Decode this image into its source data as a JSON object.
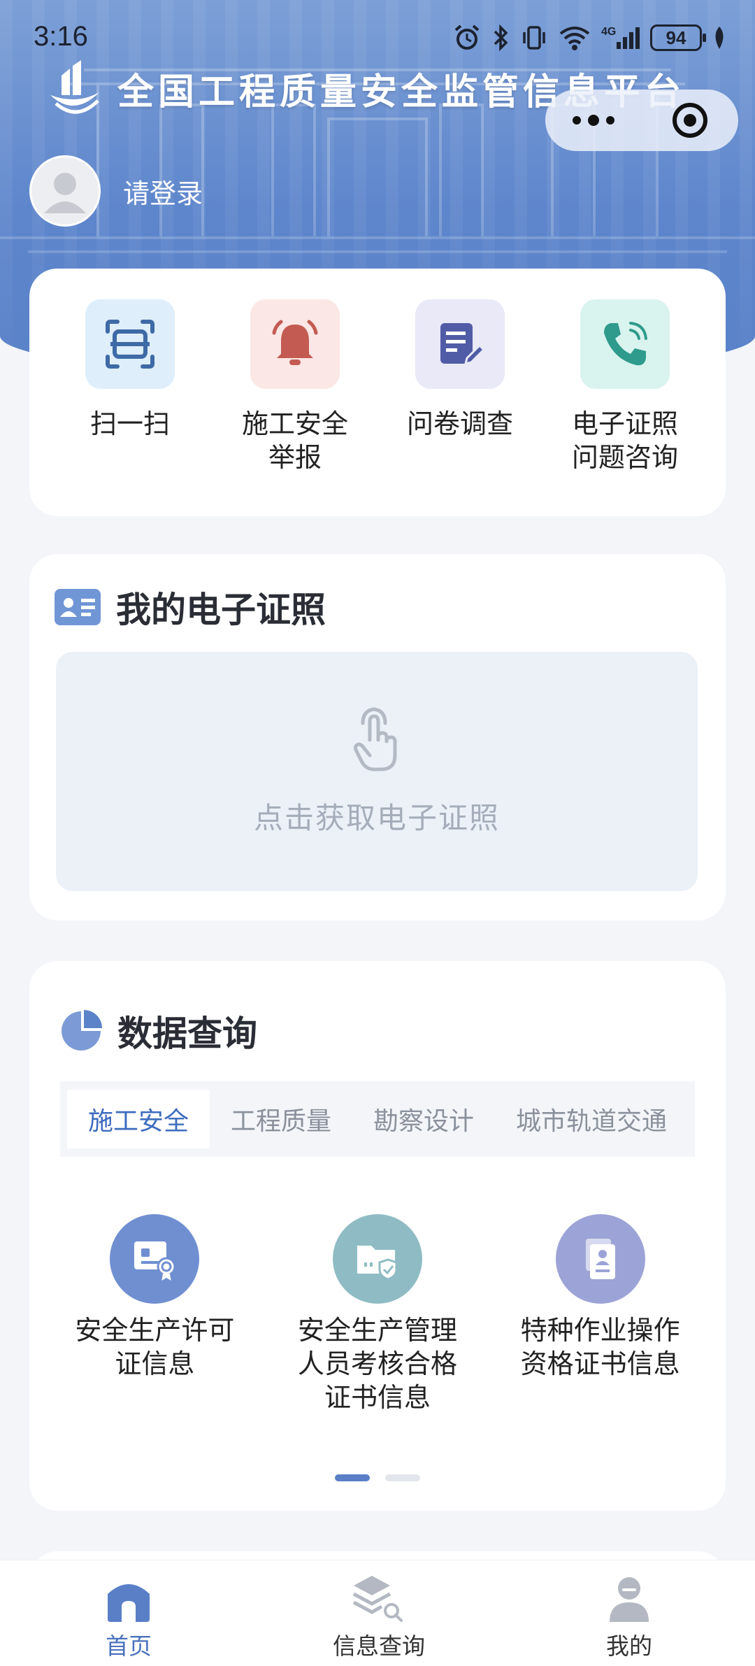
{
  "status_bar": {
    "time": "3:16",
    "battery": "94"
  },
  "header": {
    "title": "全国工程质量安全监管信息平台",
    "login_text": "请登录"
  },
  "quick_actions": [
    {
      "label": "扫一扫",
      "icon": "scan-icon",
      "bg": "#dfeefb"
    },
    {
      "label": "施工安全\n举报",
      "icon": "alarm-bell-icon",
      "bg": "#fbe7e5"
    },
    {
      "label": "问卷调查",
      "icon": "questionnaire-icon",
      "bg": "#e9e9f8"
    },
    {
      "label": "电子证照\n问题咨询",
      "icon": "phone-icon",
      "bg": "#d9f3ef"
    }
  ],
  "certificate": {
    "title": "我的电子证照",
    "hint": "点击获取电子证照"
  },
  "data_query": {
    "title": "数据查询",
    "tabs": [
      "施工安全",
      "工程质量",
      "勘察设计",
      "城市轨道交通"
    ],
    "active_tab": 0,
    "features": [
      {
        "label": "安全生产许可\n证信息",
        "icon": "license-icon",
        "color": "#6f8fd1"
      },
      {
        "label": "安全生产管理\n人员考核合格\n证书信息",
        "icon": "folder-shield-icon",
        "color": "#8fbcc4"
      },
      {
        "label": "特种作业操作\n资格证书信息",
        "icon": "document-icon",
        "color": "#9ca3d6"
      }
    ],
    "page_count": 2,
    "current_page": 0
  },
  "bottom_nav": [
    {
      "label": "首页",
      "icon": "home-icon",
      "active": true
    },
    {
      "label": "信息查询",
      "icon": "layers-search-icon",
      "active": false
    },
    {
      "label": "我的",
      "icon": "user-icon",
      "active": false
    }
  ],
  "colors": {
    "accent": "#4a72bd",
    "header_blue": "#5e86cc",
    "page_bg": "#f3f5f9"
  }
}
